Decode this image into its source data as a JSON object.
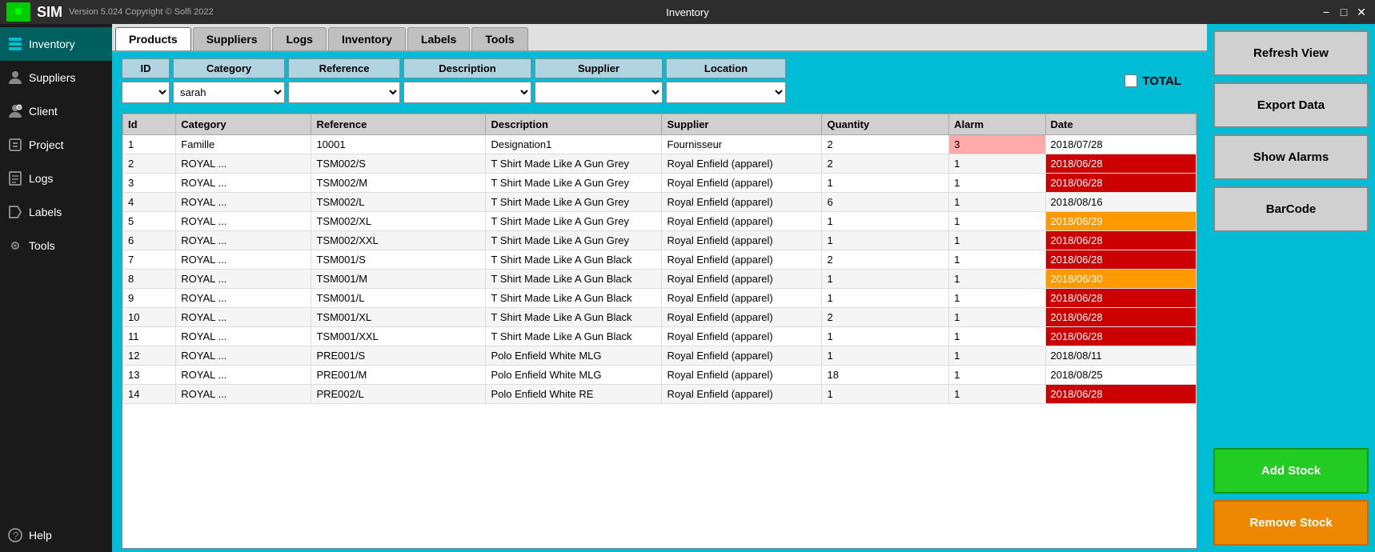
{
  "titlebar": {
    "version": "Version 5.024  Copyright © Solfi 2022",
    "title": "Inventory",
    "logo": "SIM"
  },
  "sidebar": {
    "items": [
      {
        "id": "inventory",
        "label": "Inventory",
        "active": true
      },
      {
        "id": "suppliers",
        "label": "Suppliers",
        "active": false
      },
      {
        "id": "client",
        "label": "Client",
        "active": false
      },
      {
        "id": "project",
        "label": "Project",
        "active": false
      },
      {
        "id": "logs",
        "label": "Logs",
        "active": false
      },
      {
        "id": "labels",
        "label": "Labels",
        "active": false
      },
      {
        "id": "tools",
        "label": "Tools",
        "active": false
      },
      {
        "id": "help",
        "label": "Help",
        "active": false
      }
    ]
  },
  "tabs": [
    {
      "id": "products",
      "label": "Products",
      "active": true
    },
    {
      "id": "suppliers",
      "label": "Suppliers",
      "active": false
    },
    {
      "id": "logs",
      "label": "Logs",
      "active": false
    },
    {
      "id": "inventory",
      "label": "Inventory",
      "active": false
    },
    {
      "id": "labels",
      "label": "Labels",
      "active": false
    },
    {
      "id": "tools",
      "label": "Tools",
      "active": false
    }
  ],
  "filters": {
    "id_label": "ID",
    "category_label": "Category",
    "reference_label": "Reference",
    "description_label": "Description",
    "supplier_label": "Supplier",
    "location_label": "Location",
    "category_value": "sarah",
    "total_label": "TOTAL"
  },
  "table": {
    "headers": [
      "Id",
      "Category",
      "Reference",
      "Description",
      "Supplier",
      "Quantity",
      "Alarm",
      "Date"
    ],
    "rows": [
      {
        "id": 1,
        "category": "Famille",
        "reference": "10001",
        "description": "Designation1",
        "supplier": "Fournisseur",
        "quantity": 2,
        "alarm": 3,
        "date": "2018/07/28",
        "date_class": "",
        "alarm_class": "alarm-high"
      },
      {
        "id": 2,
        "category": "ROYAL ...",
        "reference": "TSM002/S",
        "description": "T Shirt Made Like A Gun Grey",
        "supplier": "Royal Enfield (apparel)",
        "quantity": 2,
        "alarm": 1,
        "date": "2018/06/28",
        "date_class": "date-red",
        "alarm_class": ""
      },
      {
        "id": 3,
        "category": "ROYAL ...",
        "reference": "TSM002/M",
        "description": "T Shirt Made Like A Gun Grey",
        "supplier": "Royal Enfield (apparel)",
        "quantity": 1,
        "alarm": 1,
        "date": "2018/06/28",
        "date_class": "date-red",
        "alarm_class": ""
      },
      {
        "id": 4,
        "category": "ROYAL ...",
        "reference": "TSM002/L",
        "description": "T Shirt Made Like A Gun Grey",
        "supplier": "Royal Enfield (apparel)",
        "quantity": 6,
        "alarm": 1,
        "date": "2018/08/16",
        "date_class": "",
        "alarm_class": ""
      },
      {
        "id": 5,
        "category": "ROYAL ...",
        "reference": "TSM002/XL",
        "description": "T Shirt Made Like A Gun Grey",
        "supplier": "Royal Enfield (apparel)",
        "quantity": 1,
        "alarm": 1,
        "date": "2018/06/29",
        "date_class": "date-orange",
        "alarm_class": ""
      },
      {
        "id": 6,
        "category": "ROYAL ...",
        "reference": "TSM002/XXL",
        "description": "T Shirt Made Like A Gun Grey",
        "supplier": "Royal Enfield (apparel)",
        "quantity": 1,
        "alarm": 1,
        "date": "2018/06/28",
        "date_class": "date-red",
        "alarm_class": ""
      },
      {
        "id": 7,
        "category": "ROYAL ...",
        "reference": "TSM001/S",
        "description": "T Shirt Made Like A Gun Black",
        "supplier": "Royal Enfield (apparel)",
        "quantity": 2,
        "alarm": 1,
        "date": "2018/06/28",
        "date_class": "date-red",
        "alarm_class": ""
      },
      {
        "id": 8,
        "category": "ROYAL ...",
        "reference": "TSM001/M",
        "description": "T Shirt Made Like A Gun Black",
        "supplier": "Royal Enfield (apparel)",
        "quantity": 1,
        "alarm": 1,
        "date": "2018/06/30",
        "date_class": "date-orange",
        "alarm_class": ""
      },
      {
        "id": 9,
        "category": "ROYAL ...",
        "reference": "TSM001/L",
        "description": "T Shirt Made Like A Gun Black",
        "supplier": "Royal Enfield (apparel)",
        "quantity": 1,
        "alarm": 1,
        "date": "2018/06/28",
        "date_class": "date-red",
        "alarm_class": ""
      },
      {
        "id": 10,
        "category": "ROYAL ...",
        "reference": "TSM001/XL",
        "description": "T Shirt Made Like A Gun Black",
        "supplier": "Royal Enfield (apparel)",
        "quantity": 2,
        "alarm": 1,
        "date": "2018/06/28",
        "date_class": "date-red",
        "alarm_class": ""
      },
      {
        "id": 11,
        "category": "ROYAL ...",
        "reference": "TSM001/XXL",
        "description": "T Shirt Made Like A Gun Black",
        "supplier": "Royal Enfield (apparel)",
        "quantity": 1,
        "alarm": 1,
        "date": "2018/06/28",
        "date_class": "date-red",
        "alarm_class": ""
      },
      {
        "id": 12,
        "category": "ROYAL ...",
        "reference": "PRE001/S",
        "description": "Polo Enfield White MLG",
        "supplier": "Royal Enfield (apparel)",
        "quantity": 1,
        "alarm": 1,
        "date": "2018/08/11",
        "date_class": "",
        "alarm_class": ""
      },
      {
        "id": 13,
        "category": "ROYAL ...",
        "reference": "PRE001/M",
        "description": "Polo Enfield White MLG",
        "supplier": "Royal Enfield (apparel)",
        "quantity": 18,
        "alarm": 1,
        "date": "2018/08/25",
        "date_class": "",
        "alarm_class": ""
      },
      {
        "id": 14,
        "category": "ROYAL ...",
        "reference": "PRE002/L",
        "description": "Polo Enfield White RE",
        "supplier": "Royal Enfield (apparel)",
        "quantity": 1,
        "alarm": 1,
        "date": "2018/06/28",
        "date_class": "date-red",
        "alarm_class": ""
      }
    ]
  },
  "right_panel": {
    "refresh_label": "Refresh View",
    "export_label": "Export Data",
    "alarms_label": "Show Alarms",
    "barcode_label": "BarCode",
    "add_stock_label": "Add Stock",
    "remove_stock_label": "Remove Stock"
  }
}
